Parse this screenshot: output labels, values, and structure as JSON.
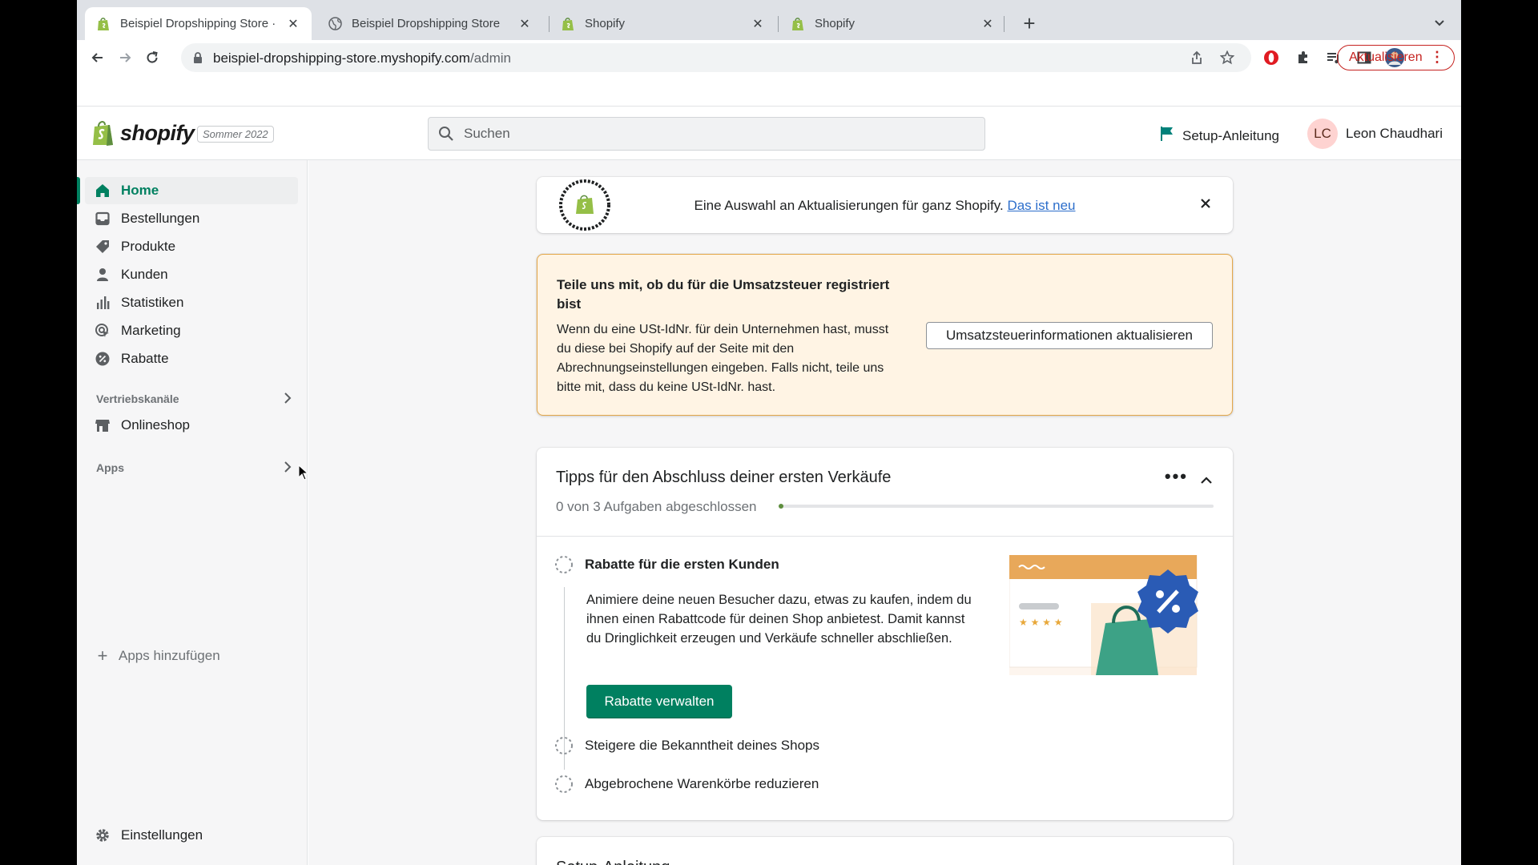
{
  "browser": {
    "tabs": [
      {
        "title": "Beispiel Dropshipping Store · Home",
        "active": true,
        "icon": "shopify-icon"
      },
      {
        "title": "Beispiel Dropshipping Store",
        "active": false,
        "icon": "globe-icon"
      },
      {
        "title": "Shopify",
        "active": false,
        "icon": "shopify-icon"
      },
      {
        "title": "Shopify",
        "active": false,
        "icon": "shopify-icon"
      }
    ],
    "url_host": "beispiel-dropshipping-store.myshopify.com",
    "url_path": "/admin",
    "update_label": "Aktualisieren"
  },
  "topbar": {
    "logo_text": "shopify",
    "edition": "Sommer 2022",
    "search_placeholder": "Suchen",
    "setup_label": "Setup-Anleitung",
    "user_initials": "LC",
    "user_name": "Leon Chaudhari"
  },
  "sidebar": {
    "items": [
      {
        "label": "Home",
        "icon": "home-icon"
      },
      {
        "label": "Bestellungen",
        "icon": "orders-icon"
      },
      {
        "label": "Produkte",
        "icon": "tag-icon"
      },
      {
        "label": "Kunden",
        "icon": "person-icon"
      },
      {
        "label": "Statistiken",
        "icon": "bar-chart-icon"
      },
      {
        "label": "Marketing",
        "icon": "target-icon"
      },
      {
        "label": "Rabatte",
        "icon": "discount-icon"
      }
    ],
    "sales_channels_header": "Vertriebskanäle",
    "online_store": "Onlineshop",
    "apps_header": "Apps",
    "add_apps": "Apps hinzufügen",
    "settings": "Einstellungen"
  },
  "banner": {
    "text": "Eine Auswahl an Aktualisierungen für ganz Shopify.",
    "link": "Das ist neu"
  },
  "tax": {
    "title": "Teile uns mit, ob du für die Umsatzsteuer registriert bist",
    "body": "Wenn du eine USt-IdNr. für dein Unternehmen hast, musst du diese bei Shopify auf der Seite mit den Abrechnungseinstellungen eingeben. Falls nicht, teile uns bitte mit, dass du keine USt-IdNr. hast.",
    "button": "Umsatzsteuerinformationen aktualisieren"
  },
  "tips": {
    "title": "Tipps für den Abschluss deiner ersten Verkäufe",
    "progress_text": "0 von 3 Aufgaben abgeschlossen",
    "progress_fraction": 0,
    "tasks": [
      {
        "title": "Rabatte für die ersten Kunden"
      },
      {
        "title": "Steigere die Bekanntheit deines Shops"
      },
      {
        "title": "Abgebrochene Warenkörbe reduzieren"
      }
    ],
    "description": "Animiere deine neuen Besucher dazu, etwas zu kaufen, indem du ihnen einen Rabattcode für deinen Shop anbietest. Damit kannst du Dringlichkeit erzeugen und Verkäufe schneller abschließen.",
    "primary_button": "Rabatte verwalten"
  },
  "setup_card": {
    "title": "Setup-Anleitung"
  },
  "colors": {
    "brand_green": "#008060",
    "warning_bg": "#fff4e4",
    "warning_border": "#e4a84a",
    "link_blue": "#2c6ecb"
  }
}
